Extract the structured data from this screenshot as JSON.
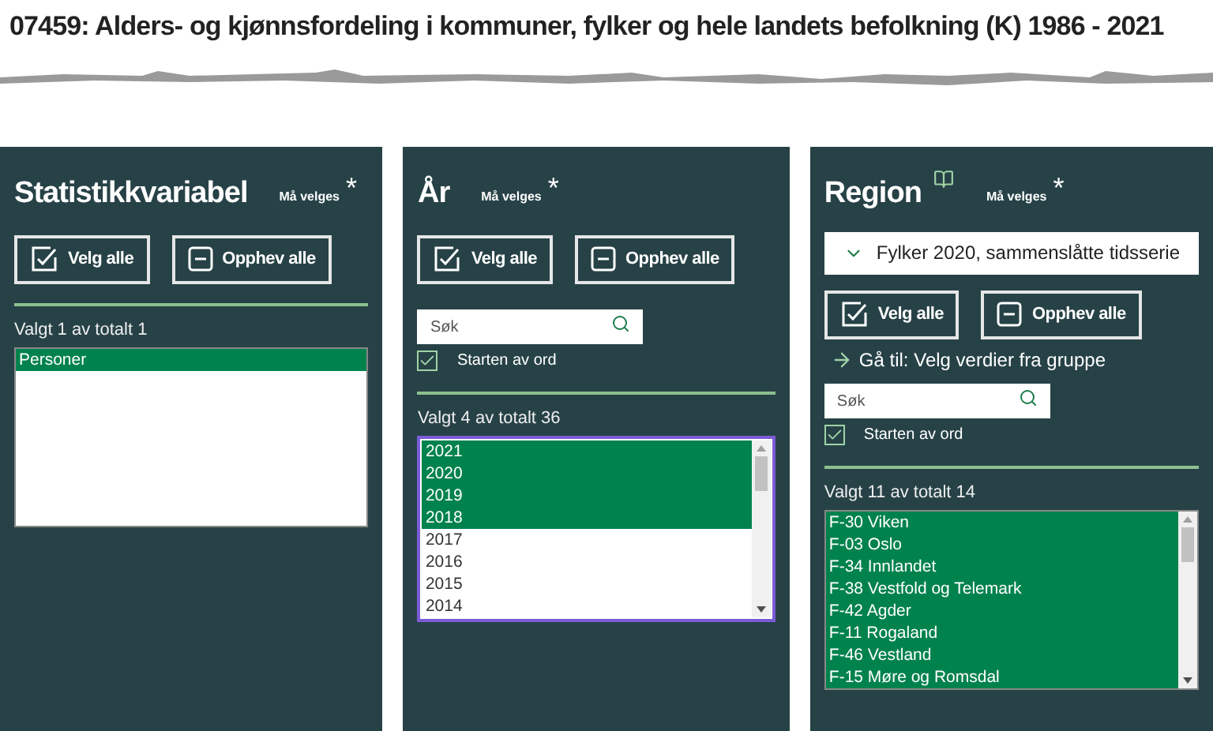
{
  "title": "07459: Alders- og kjønnsfordeling i kommuner, fylker og hele landets befolkning (K) 1986 - 2021",
  "panels": [
    {
      "title": "Statistikkvariabel",
      "info_icon": false,
      "required": "Må velges",
      "star": "*",
      "buttons": [
        "Velg alle",
        "Opphev alle"
      ],
      "count": "Valgt 1 av totalt 1",
      "focused": false,
      "scrollbar": false,
      "items": [
        {
          "label": "Personer",
          "selected": true
        }
      ]
    },
    {
      "title": "År",
      "info_icon": false,
      "required": "Må velges",
      "star": "*",
      "buttons": [
        "Velg alle",
        "Opphev alle"
      ],
      "search": {
        "placeholder": "Søk",
        "option": "Starten av ord",
        "checked": true
      },
      "count": "Valgt 4 av totalt 36",
      "focused": true,
      "scrollbar": true,
      "items": [
        {
          "label": "2021",
          "selected": true
        },
        {
          "label": "2020",
          "selected": true
        },
        {
          "label": "2019",
          "selected": true
        },
        {
          "label": "2018",
          "selected": true
        },
        {
          "label": "2017",
          "selected": false
        },
        {
          "label": "2016",
          "selected": false
        },
        {
          "label": "2015",
          "selected": false
        },
        {
          "label": "2014",
          "selected": false
        }
      ]
    },
    {
      "title": "Region",
      "info_icon": true,
      "required": "Må velges",
      "star": "*",
      "dropdown": "Fylker 2020, sammenslåtte tidsserie",
      "buttons": [
        "Velg alle",
        "Opphev alle"
      ],
      "goto": "Gå til: Velg verdier fra gruppe",
      "search": {
        "placeholder": "Søk",
        "option": "Starten av ord",
        "checked": true
      },
      "count": "Valgt 11 av totalt 14",
      "focused": false,
      "scrollbar": true,
      "items": [
        {
          "label": "F-30 Viken",
          "selected": true
        },
        {
          "label": "F-03 Oslo",
          "selected": true
        },
        {
          "label": "F-34 Innlandet",
          "selected": true
        },
        {
          "label": "F-38 Vestfold og Telemark",
          "selected": true
        },
        {
          "label": "F-42 Agder",
          "selected": true
        },
        {
          "label": "F-11 Rogaland",
          "selected": true
        },
        {
          "label": "F-46 Vestland",
          "selected": true
        },
        {
          "label": "F-15 Møre og Romsdal",
          "selected": true
        }
      ]
    }
  ]
}
